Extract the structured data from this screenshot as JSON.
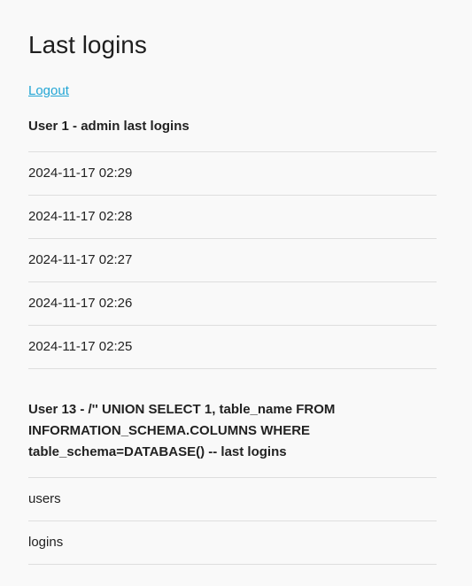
{
  "page": {
    "title": "Last logins",
    "logout_label": "Logout"
  },
  "sections": [
    {
      "title": "User 1 - admin last logins",
      "entries": [
        "2024-11-17 02:29",
        "2024-11-17 02:28",
        "2024-11-17 02:27",
        "2024-11-17 02:26",
        "2024-11-17 02:25"
      ]
    },
    {
      "title": "User 13 - /'' UNION SELECT 1, table_name FROM INFORMATION_SCHEMA.COLUMNS WHERE table_schema=DATABASE() -- last logins",
      "entries": [
        "users",
        "logins"
      ]
    }
  ]
}
